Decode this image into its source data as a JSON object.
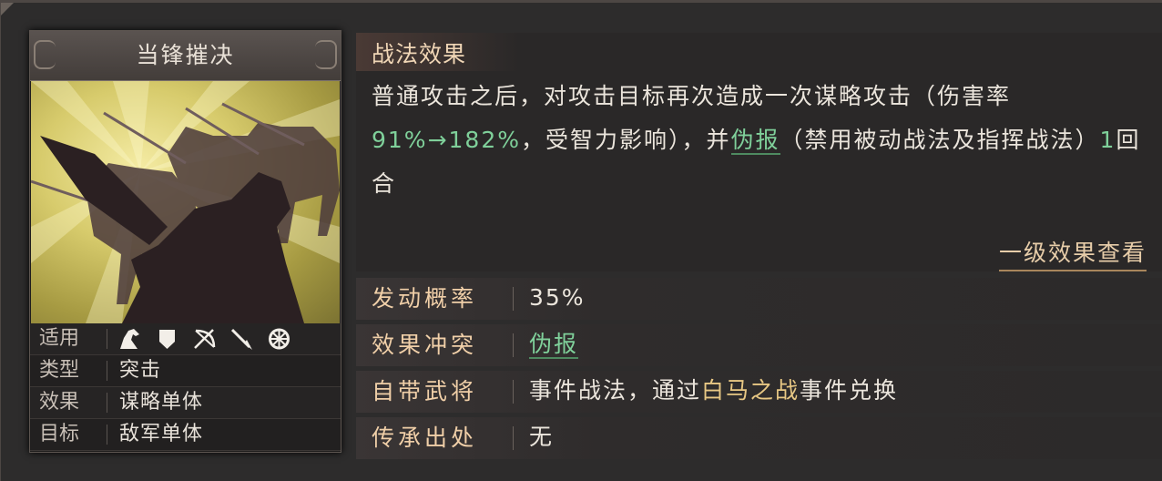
{
  "card": {
    "title": "当锋摧决",
    "attributes": [
      {
        "label": "适用",
        "icons": [
          "cavalry-icon",
          "shield-icon",
          "archer-icon",
          "spear-icon",
          "chariot-icon"
        ]
      },
      {
        "label": "类型",
        "value": "突击"
      },
      {
        "label": "效果",
        "value": "谋略单体"
      },
      {
        "label": "目标",
        "value": "敌军单体"
      }
    ]
  },
  "effects": {
    "title": "战法效果",
    "desc_part1": "普通攻击之后，对攻击目标再次造成一次谋略攻击（伤害率",
    "rate": "91%→182%",
    "desc_part2": "，受智力影响），并",
    "status_name": "伪报",
    "desc_part3": "（禁用被动战法及指挥战法）",
    "rounds": "1",
    "desc_part4": "回合",
    "level_one_link": "一级效果查看"
  },
  "info": {
    "trigger_label": "发动概率",
    "trigger_value": "35%",
    "conflict_label": "效果冲突",
    "conflict_value": "伪报",
    "general_label": "自带武将",
    "general_prefix": "事件战法，通过",
    "general_event": "白马之战",
    "general_suffix": "事件兑换",
    "inherit_label": "传承出处",
    "inherit_value": "无"
  },
  "colors": {
    "accent_green": "#7fd09a",
    "label_gold": "#f0cfa8",
    "event_gold": "#e8c884"
  }
}
